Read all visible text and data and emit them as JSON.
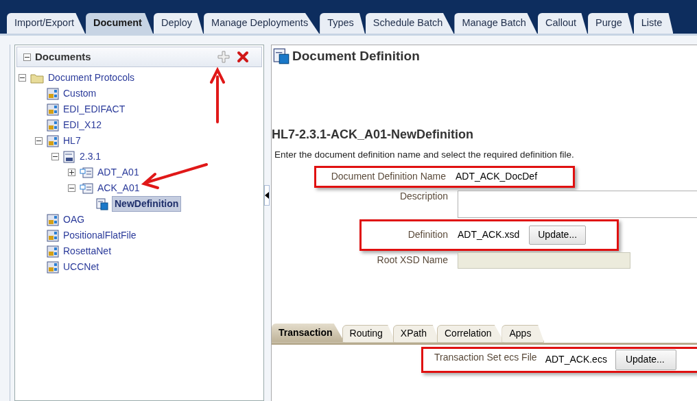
{
  "main_tabs": [
    {
      "label": "Import/Export",
      "selected": false
    },
    {
      "label": "Document",
      "selected": true
    },
    {
      "label": "Deploy",
      "selected": false
    },
    {
      "label": "Manage Deployments",
      "selected": false
    },
    {
      "label": "Types",
      "selected": false
    },
    {
      "label": "Schedule Batch",
      "selected": false
    },
    {
      "label": "Manage Batch",
      "selected": false
    },
    {
      "label": "Callout",
      "selected": false
    },
    {
      "label": "Purge",
      "selected": false
    },
    {
      "label": "Liste",
      "selected": false
    }
  ],
  "documents_panel": {
    "title": "Documents",
    "expanded": true,
    "tree": [
      {
        "label": "Document Protocols",
        "kind": "folder",
        "expanded": true,
        "selected": false,
        "children": [
          {
            "label": "Custom",
            "kind": "protocol",
            "selected": false
          },
          {
            "label": "EDI_EDIFACT",
            "kind": "protocol",
            "selected": false
          },
          {
            "label": "EDI_X12",
            "kind": "protocol",
            "selected": false
          },
          {
            "label": "HL7",
            "kind": "protocol",
            "expanded": true,
            "selected": false,
            "children": [
              {
                "label": "2.3.1",
                "kind": "version",
                "expanded": true,
                "selected": false,
                "children": [
                  {
                    "label": "ADT_A01",
                    "kind": "doctype",
                    "expanded": false,
                    "selected": false
                  },
                  {
                    "label": "ACK_A01",
                    "kind": "doctype",
                    "expanded": true,
                    "selected": false,
                    "children": [
                      {
                        "label": "NewDefinition",
                        "kind": "definition",
                        "selected": true
                      }
                    ]
                  }
                ]
              }
            ]
          },
          {
            "label": "OAG",
            "kind": "protocol",
            "selected": false
          },
          {
            "label": "PositionalFlatFile",
            "kind": "protocol",
            "selected": false
          },
          {
            "label": "RosettaNet",
            "kind": "protocol",
            "selected": false
          },
          {
            "label": "UCCNet",
            "kind": "protocol",
            "selected": false
          }
        ]
      }
    ]
  },
  "definition": {
    "title": "Document Definition",
    "heading": "HL7-2.3.1-ACK_A01-NewDefinition",
    "instructions": "Enter the document definition name and select the required definition file.",
    "fields": [
      {
        "kind": "text",
        "label": "Document Definition Name",
        "value": "ADT_ACK_DocDef",
        "highlighted": true
      },
      {
        "kind": "textarea",
        "label": "Description"
      },
      {
        "kind": "file",
        "label": "Definition",
        "value": "ADT_ACK.xsd",
        "button": "Update...",
        "highlighted": true
      },
      {
        "kind": "readonly",
        "label": "Root XSD Name"
      }
    ],
    "sub_tabs": [
      {
        "label": "Transaction",
        "selected": true
      },
      {
        "label": "Routing",
        "selected": false
      },
      {
        "label": "XPath",
        "selected": false
      },
      {
        "label": "Correlation",
        "selected": false
      },
      {
        "label": "Apps",
        "selected": false
      }
    ],
    "transaction": {
      "label": "Transaction Set ecs File",
      "value": "ADT_ACK.ecs",
      "button": "Update...",
      "highlighted": true
    }
  }
}
